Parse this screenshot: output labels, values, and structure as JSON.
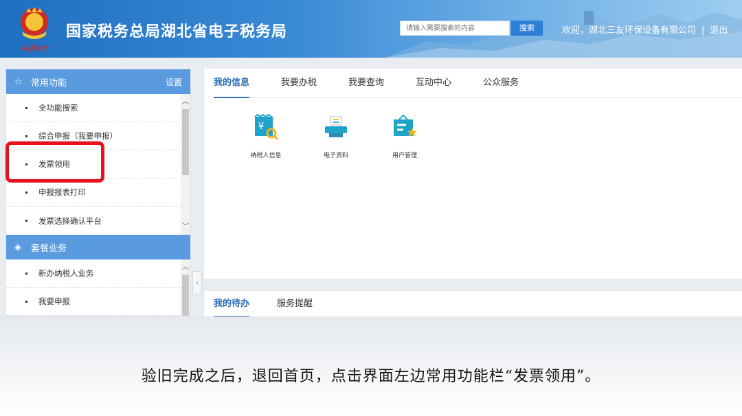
{
  "header": {
    "logo_text": "中国税务",
    "title": "国家税务总局湖北省电子税务局",
    "search_placeholder": "请输入需要搜索的内容",
    "search_button": "搜索",
    "welcome": "欢迎，湖北三友环保设备有限公司",
    "separator": "|",
    "logout": "退出"
  },
  "sidebar": {
    "common_header": "常用功能",
    "settings": "设置",
    "common_items": [
      "全功能搜索",
      "综合申报（我要申报）",
      "发票领用",
      "申报报表打印",
      "发票选择确认平台"
    ],
    "package_header": "套餐业务",
    "package_items": [
      "新办纳税人业务",
      "我要申报"
    ],
    "highlighted_item": "发票领用",
    "highlight_color": "#e8121d"
  },
  "main": {
    "tabs": [
      "我的信息",
      "我要办税",
      "我要查询",
      "互动中心",
      "公众服务"
    ],
    "active_tab": "我的信息",
    "tiles": [
      {
        "label": "纳税人信息",
        "icon": "taxpayer-info-icon"
      },
      {
        "label": "电子资料",
        "icon": "electronic-documents-icon"
      },
      {
        "label": "用户管理",
        "icon": "user-management-icon"
      }
    ],
    "bottom_tabs": [
      "我的待办",
      "服务提醒"
    ]
  },
  "caption": "验旧完成之后，退回首页，点击界面左边常用功能栏“发票领用”。",
  "colors": {
    "header_blue": "#2d7fd6",
    "sidebar_blue": "#5a9be0",
    "tab_active": "#2e6db8",
    "icon_teal": "#1fa3c8",
    "icon_gold": "#f2b41e"
  }
}
